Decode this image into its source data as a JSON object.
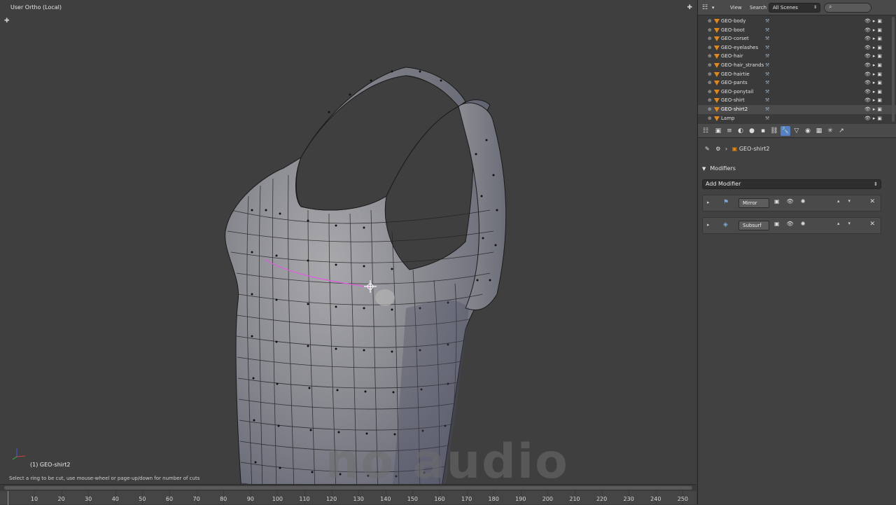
{
  "viewport": {
    "title": "User Ortho (Local)",
    "object_label": "(1) GEO-shirt2",
    "status": "Select a ring to be cut, use mouse-wheel or page-up/down for number of cuts",
    "watermark": "no audio"
  },
  "timeline": {
    "ticks": [
      "10",
      "20",
      "30",
      "40",
      "50",
      "60",
      "70",
      "80",
      "90",
      "100",
      "110",
      "120",
      "130",
      "140",
      "150",
      "160",
      "170",
      "180",
      "190",
      "200",
      "210",
      "220",
      "230",
      "240",
      "250"
    ]
  },
  "outliner": {
    "view_label": "View",
    "search_label": "Search",
    "scenes_select": "All Scenes",
    "items": [
      {
        "name": "GEO-body",
        "selected": false
      },
      {
        "name": "GEO-boot",
        "selected": false
      },
      {
        "name": "GEO-corset",
        "selected": false
      },
      {
        "name": "GEO-eyelashes",
        "selected": false
      },
      {
        "name": "GEO-hair",
        "selected": false
      },
      {
        "name": "GEO-hair_strands",
        "selected": false
      },
      {
        "name": "GEO-hairtie",
        "selected": false
      },
      {
        "name": "GEO-pants",
        "selected": false
      },
      {
        "name": "GEO-ponytail",
        "selected": false
      },
      {
        "name": "GEO-shirt",
        "selected": false
      },
      {
        "name": "GEO-shirt2",
        "selected": true
      },
      {
        "name": "Lamp",
        "selected": false
      }
    ]
  },
  "properties": {
    "breadcrumb_object": "GEO-shirt2",
    "section_title": "Modifiers",
    "add_modifier_label": "Add Modifier",
    "modifiers": [
      {
        "name": "Mirror"
      },
      {
        "name": "Subsurf"
      }
    ]
  },
  "colors": {
    "viewport_bg": "#3f3f3f",
    "panel_bg": "#414141",
    "accent": "#5680c2",
    "edge_loop": "#e05ae0",
    "object_orange": "#e0881e"
  }
}
